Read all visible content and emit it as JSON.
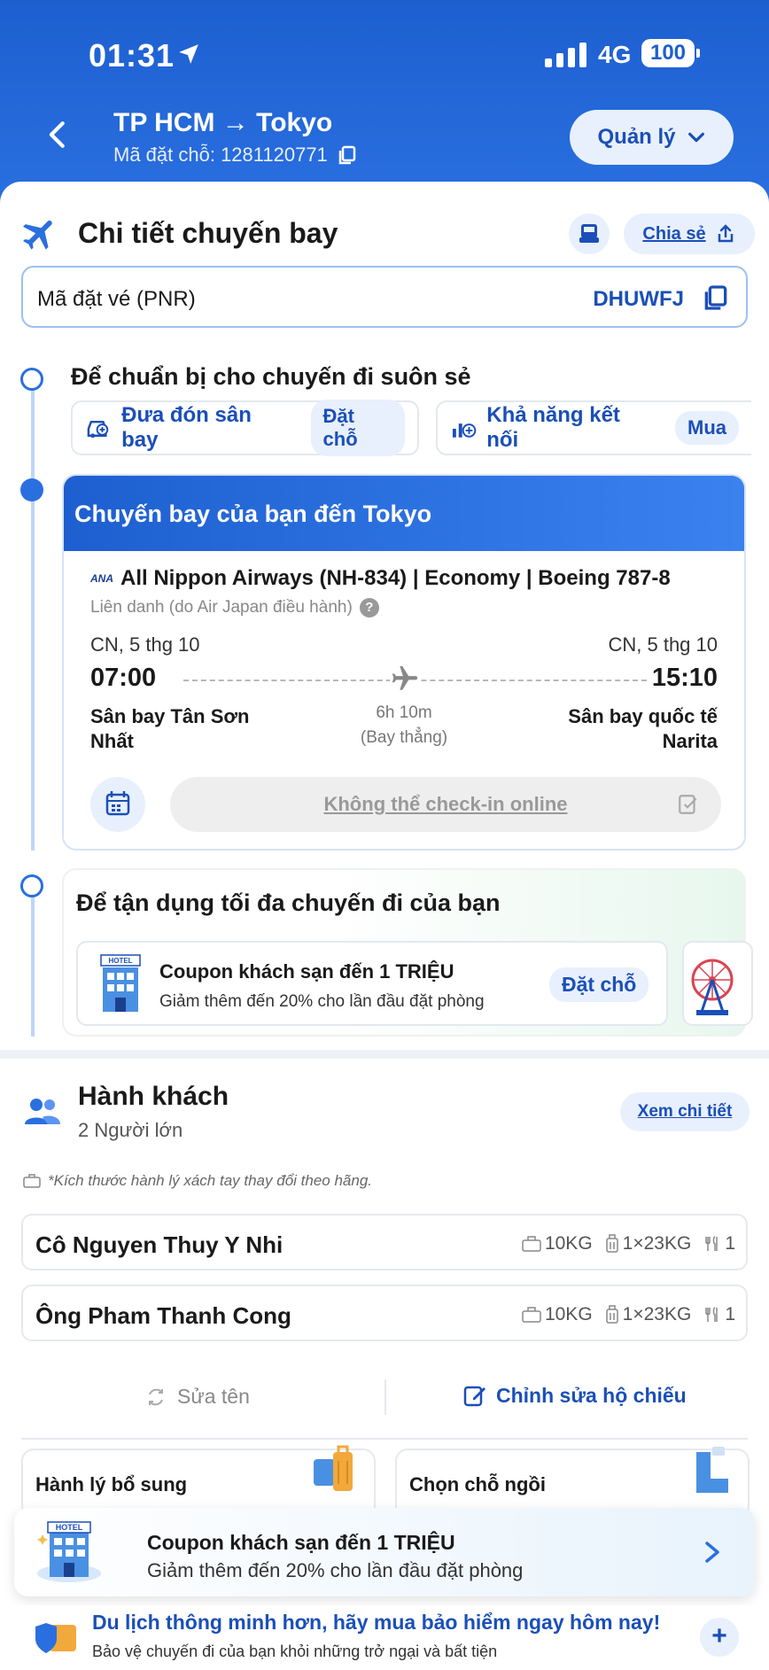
{
  "status_bar": {
    "time": "01:31",
    "network": "4G",
    "battery": "100"
  },
  "header": {
    "route": "TP HCM → Tokyo",
    "booking_code": "Mã đặt chỗ: 1281120771",
    "manage_label": "Quản lý"
  },
  "flight_details": {
    "title": "Chi tiết chuyến bay",
    "share_label": "Chia sẻ",
    "pnr_label": "Mã đặt vé (PNR)",
    "pnr_value": "DHUWFJ"
  },
  "prepare": {
    "title": "Để chuẩn bị cho chuyến đi suôn sẻ",
    "chips": [
      {
        "label": "Đưa đón sân bay",
        "action": "Đặt chỗ",
        "icon": "car-icon"
      },
      {
        "label": "Khả năng kết nối",
        "action": "Mua",
        "icon": "connectivity-icon"
      }
    ]
  },
  "flight": {
    "banner": "Chuyến bay của bạn đến Tokyo",
    "airline_logo": "ANA",
    "airline": "All Nippon Airways (NH-834) | Economy | Boeing 787-8",
    "codeshare": "Liên danh (do Air Japan điều hành)",
    "dep_date": "CN, 5 thg 10",
    "arr_date": "CN, 5 thg 10",
    "dep_time": "07:00",
    "arr_time": "15:10",
    "dep_airport": "Sân bay Tân Sơn Nhất",
    "arr_airport": "Sân bay quốc tế Narita",
    "duration": "6h 10m",
    "stops": "(Bay thẳng)",
    "checkin_label": "Không thể check-in online"
  },
  "maximize": {
    "title": "Để tận dụng tối đa chuyến đi của bạn",
    "hotel_badge": "HOTEL",
    "hotel_title": "Coupon khách sạn đến 1 TRIỆU",
    "hotel_sub": "Giảm thêm đến 20% cho lần đầu đặt phòng",
    "hotel_action": "Đặt chỗ"
  },
  "passengers": {
    "title": "Hành khách",
    "count": "2 Người lớn",
    "detail_label": "Xem chi tiết",
    "bag_note": "*Kích thước hành lý xách tay thay đổi theo hãng.",
    "list": [
      {
        "name": "Cô Nguyen Thuy Y Nhi",
        "cabin": "10KG",
        "checked": "1×23KG",
        "meal": "1"
      },
      {
        "name": "Ông Pham Thanh Cong",
        "cabin": "10KG",
        "checked": "1×23KG",
        "meal": "1"
      }
    ],
    "edit_name": "Sửa tên",
    "edit_passport": "Chỉnh sửa hộ chiếu",
    "addons": [
      "Hành lý bổ sung",
      "Chọn chỗ ngồi"
    ]
  },
  "float_coupon": {
    "badge": "HOTEL",
    "title": "Coupon khách sạn đến 1 TRIỆU",
    "sub": "Giảm thêm đến 20% cho lần đầu đặt phòng"
  },
  "insurance": {
    "title": "Du lịch thông minh hơn, hãy mua bảo hiểm ngay hôm nay!",
    "sub": "Bảo vệ chuyến đi của bạn khỏi những trở ngại và bất tiện"
  },
  "colors": {
    "primary": "#2a6fe0",
    "accent_text": "#1b4fb8",
    "chip_bg": "#e8f0fd"
  }
}
